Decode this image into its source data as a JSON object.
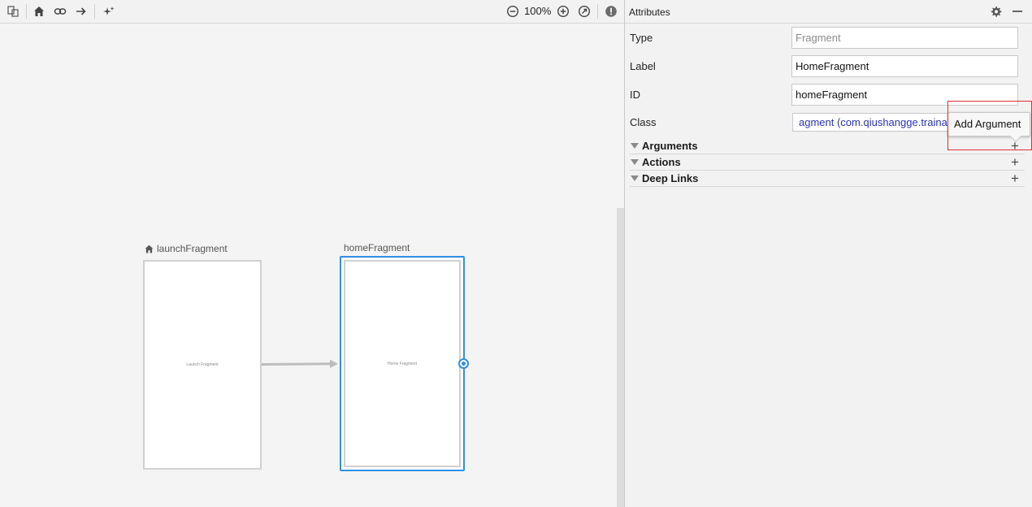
{
  "toolbar": {
    "zoom_level": "100%"
  },
  "graph": {
    "launch": {
      "name": "launchFragment",
      "caption": "Launch Fragment"
    },
    "home": {
      "name": "homeFragment",
      "caption": "Home Fragment"
    }
  },
  "attributes": {
    "title": "Attributes",
    "type_label": "Type",
    "type_placeholder": "Fragment",
    "label_label": "Label",
    "label_value": "HomeFragment",
    "id_label": "ID",
    "id_value": "homeFragment",
    "class_label": "Class",
    "class_value": "agment (com.qiushangge.traina",
    "sections": [
      {
        "title": "Arguments"
      },
      {
        "title": "Actions"
      },
      {
        "title": "Deep Links"
      }
    ]
  },
  "tooltip": {
    "text": "Add Argument"
  },
  "colors": {
    "accent": "#2f8fe5",
    "class_text": "#2a33b8",
    "highlight": "#e03030"
  }
}
